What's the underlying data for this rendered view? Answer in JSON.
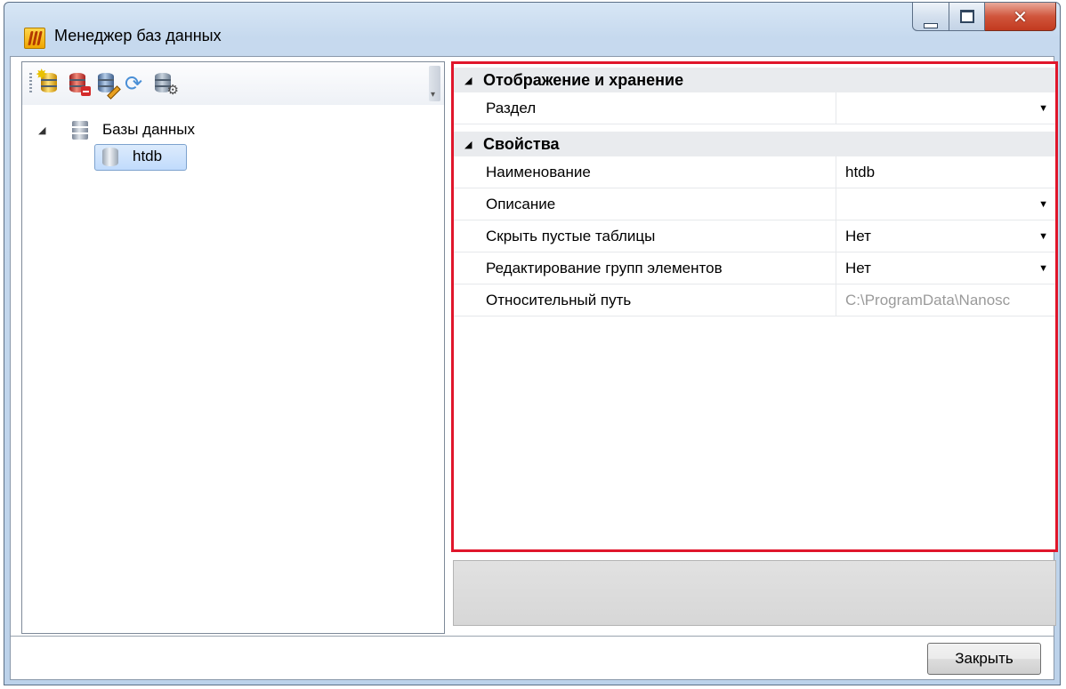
{
  "window": {
    "title": "Менеджер баз данных"
  },
  "toolbar": {
    "buttons": [
      "add-database-icon",
      "remove-database-icon",
      "edit-database-icon",
      "refresh-icon",
      "database-settings-icon"
    ]
  },
  "tree": {
    "root_label": "Базы данных",
    "child_label": "htdb"
  },
  "properties": {
    "categories": [
      {
        "label": "Отображение и хранение",
        "rows": [
          {
            "name": "Раздел",
            "value": "",
            "dropdown": true
          }
        ]
      },
      {
        "label": "Свойства",
        "rows": [
          {
            "name": "Наименование",
            "value": "htdb",
            "dropdown": false
          },
          {
            "name": "Описание",
            "value": "",
            "dropdown": true
          },
          {
            "name": "Скрыть пустые таблицы",
            "value": "Нет",
            "dropdown": true
          },
          {
            "name": "Редактирование групп элементов",
            "value": "Нет",
            "dropdown": true
          },
          {
            "name": "Относительный путь",
            "value": "C:\\ProgramData\\Nanosc",
            "dropdown": false,
            "readonly": true
          }
        ]
      }
    ]
  },
  "footer": {
    "close_label": "Закрыть"
  },
  "colors": {
    "highlight_border": "#e0162b",
    "selection": "#c1dbfc"
  }
}
